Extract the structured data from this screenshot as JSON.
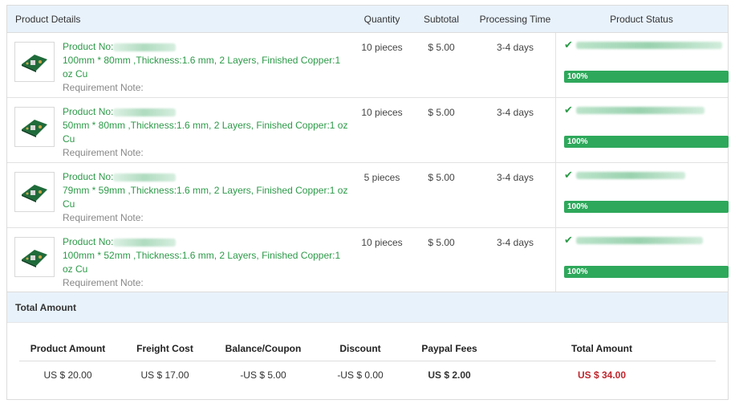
{
  "products_table": {
    "headers": {
      "details": "Product Details",
      "quantity": "Quantity",
      "subtotal": "Subtotal",
      "processing": "Processing Time",
      "status": "Product Status"
    },
    "rows": [
      {
        "product_no_label": "Product No:",
        "spec": "100mm * 80mm ,Thickness:1.6 mm, 2 Layers, Finished Copper:1 oz Cu",
        "note_label": "Requirement Note:",
        "quantity": "10 pieces",
        "subtotal": "$ 5.00",
        "processing": "3-4 days",
        "progress_label": "100%",
        "progress": 1.0
      },
      {
        "product_no_label": "Product No:",
        "spec": "50mm * 80mm ,Thickness:1.6 mm, 2 Layers, Finished Copper:1 oz Cu",
        "note_label": "Requirement Note:",
        "quantity": "10 pieces",
        "subtotal": "$ 5.00",
        "processing": "3-4 days",
        "progress_label": "100%",
        "progress": 1.0
      },
      {
        "product_no_label": "Product No:",
        "spec": "79mm * 59mm ,Thickness:1.6 mm, 2 Layers, Finished Copper:1 oz Cu",
        "note_label": "Requirement Note:",
        "quantity": "5 pieces",
        "subtotal": "$ 5.00",
        "processing": "3-4 days",
        "progress_label": "100%",
        "progress": 1.0
      },
      {
        "product_no_label": "Product No:",
        "spec": "100mm * 52mm ,Thickness:1.6 mm, 2 Layers, Finished Copper:1 oz Cu",
        "note_label": "Requirement Note:",
        "quantity": "10 pieces",
        "subtotal": "$ 5.00",
        "processing": "3-4 days",
        "progress_label": "100%",
        "progress": 1.0
      }
    ]
  },
  "totals": {
    "title": "Total Amount",
    "headers": {
      "product_amount": "Product Amount",
      "freight_cost": "Freight Cost",
      "balance_coupon": "Balance/Coupon",
      "discount": "Discount",
      "paypal_fees": "Paypal Fees",
      "total_amount": "Total Amount"
    },
    "values": {
      "product_amount": "US $ 20.00",
      "freight_cost": "US $ 17.00",
      "balance_coupon": "-US $ 5.00",
      "discount": "-US $ 0.00",
      "paypal_fees": "US $ 2.00",
      "total_amount": "US $ 34.00"
    }
  },
  "colors": {
    "accent_green": "#2c9a48",
    "progress_green": "#2ea85b",
    "header_bg": "#e8f2fb",
    "total_red": "#c0262d"
  },
  "icons": {
    "status": "check-icon",
    "thumbnail": "pcb-board-icon"
  }
}
